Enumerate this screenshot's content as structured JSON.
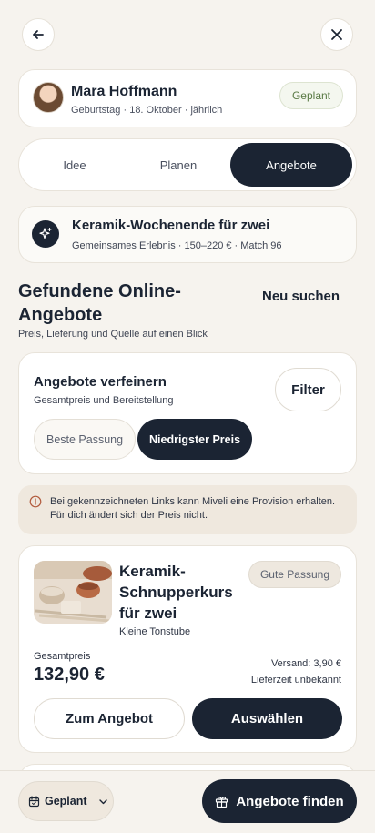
{
  "header": {
    "back_icon": "arrow-left-icon",
    "close_icon": "close-icon"
  },
  "person": {
    "name": "Mara Hoffmann",
    "occasion": "Geburtstag · 18. Oktober · jährlich",
    "status": "Geplant"
  },
  "tabs": [
    {
      "label": "Idee",
      "active": false
    },
    {
      "label": "Planen",
      "active": false
    },
    {
      "label": "Angebote",
      "active": true
    }
  ],
  "idea": {
    "icon": "sparkle-icon",
    "title": "Keramik-Wochenende für zwei",
    "meta": "Gemeinsames Erlebnis · 150–220 € · Match 96"
  },
  "section": {
    "title": "Gefundene Online-Angebote",
    "subtitle": "Preis, Lieferung und Quelle auf einen Blick",
    "new_search": "Neu suchen"
  },
  "refine": {
    "title": "Angebote verfeinern",
    "subtitle": "Gesamtpreis und Bereitstellung",
    "filter_label": "Filter",
    "chips": [
      {
        "label": "Beste Passung",
        "selected": false
      },
      {
        "label": "Niedrigster Preis",
        "selected": true
      }
    ]
  },
  "notice": {
    "icon": "info-icon",
    "text": "Bei gekennzeichneten Links kann Miveli eine Provision erhalten. Für dich ändert sich der Preis nicht."
  },
  "offer": {
    "title": "Keramik-Schnupperkurs für zwei",
    "shop": "Kleine Tonstube",
    "badge": "Gute Passung",
    "price_label": "Gesamtpreis",
    "price": "132,90 €",
    "shipping": "Versand: 3,90 €",
    "delivery": "Lieferzeit unbekannt",
    "secondary_action": "Zum Angebot",
    "primary_action": "Auswählen"
  },
  "bottom_bar": {
    "status_label": "Geplant",
    "status_icon": "calendar-icon",
    "find_label": "Angebote finden",
    "find_icon": "gift-icon"
  },
  "colors": {
    "primary": "#1b2433",
    "background": "#f6f3ee",
    "success": "#5a7a45",
    "notice_bg": "#efe8de"
  }
}
